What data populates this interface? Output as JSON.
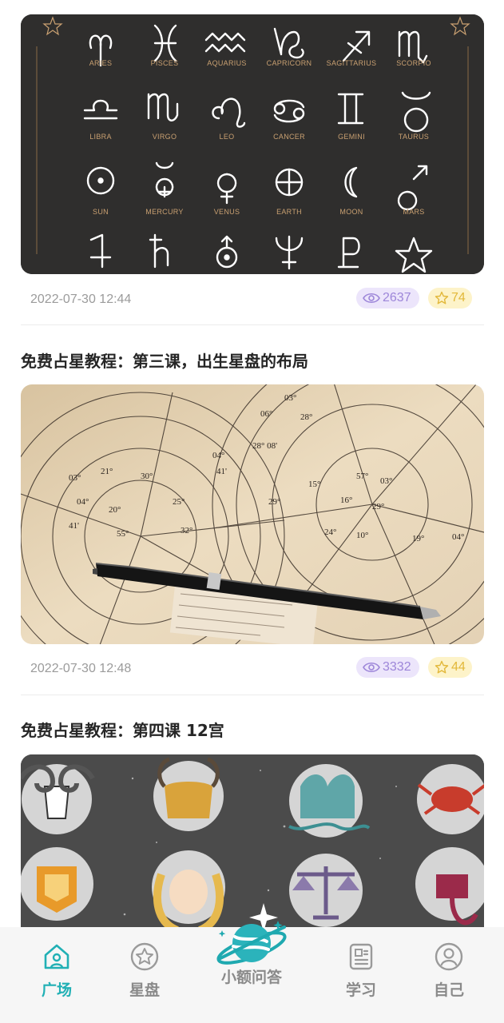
{
  "posts": [
    {
      "image_alt": "zodiac symbols chart",
      "zodiac_labels": [
        "ARIES",
        "PISCES",
        "AQUARIUS",
        "CAPRICORN",
        "SAGITTARIUS",
        "SCORPIO",
        "LIBRA",
        "VIRGO",
        "LEO",
        "CANCER",
        "GEMINI",
        "TAURUS",
        "SUN",
        "MERCURY",
        "VENUS",
        "EARTH",
        "MOON",
        "MARS"
      ],
      "date": "2022-07-30 12:44",
      "views": "2637",
      "stars": "74"
    },
    {
      "title": "免费占星教程：第三课，出生星盘的布局",
      "image_alt": "birth chart with pen",
      "date": "2022-07-30 12:48",
      "views": "3332",
      "stars": "44"
    },
    {
      "title": "免费占星教程：第四课 12宫",
      "image_alt": "twelve zodiac illustrations"
    }
  ],
  "nav": {
    "items": [
      {
        "label": "广场",
        "icon": "home-icon",
        "active": true
      },
      {
        "label": "星盘",
        "icon": "star-circle-icon"
      },
      {
        "label": "小额问答",
        "icon": "planet-icon"
      },
      {
        "label": "学习",
        "icon": "document-icon"
      },
      {
        "label": "自己",
        "icon": "profile-icon"
      }
    ]
  },
  "colors": {
    "accent": "#21b0b5",
    "views_badge_bg": "#ece5fb",
    "stars_badge_bg": "#fdf3c9"
  }
}
